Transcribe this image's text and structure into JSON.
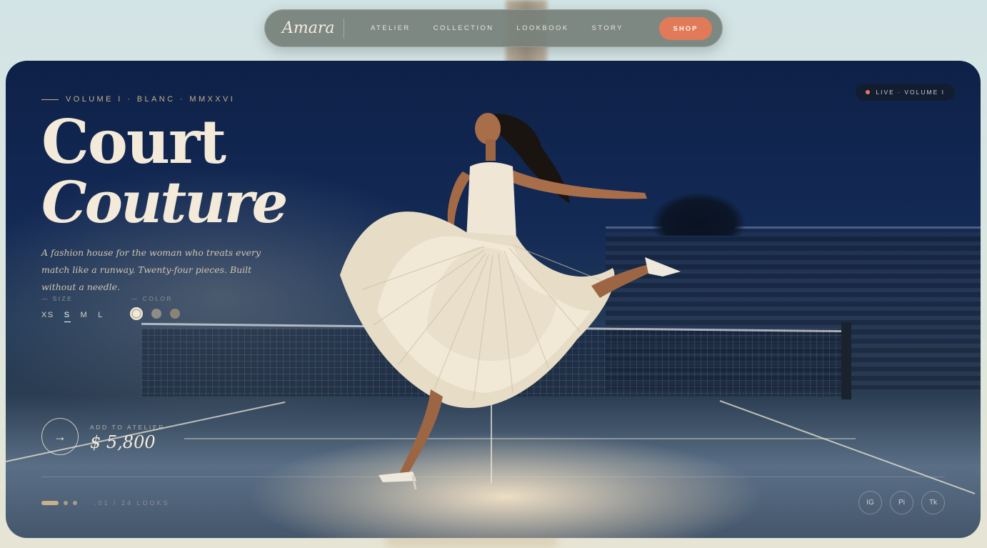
{
  "nav": {
    "brand": "Amara",
    "links": [
      "ATELIER",
      "COLLECTION",
      "LOOKBOOK",
      "STORY"
    ],
    "cta": "SHOP"
  },
  "hero": {
    "eyebrow": "VOLUME I · BLANC · MMXXVI",
    "title_line1": "Court",
    "title_line2": "Couture",
    "trademark": "™",
    "tagline": "A fashion house for the woman who treats every match like a runway. Twenty-four pieces. Built without a needle.",
    "size_label": "— SIZE",
    "sizes": [
      "XS",
      "S",
      "M",
      "L"
    ],
    "selected_size": "S",
    "color_label": "— COLOR",
    "colors": [
      "#f3ead9",
      "#8e8c85",
      "#8a8476"
    ],
    "cta_label": "ADD TO ATELIER",
    "price": "$ 5,800",
    "arrow": "→",
    "looks": ".01 / 24 LOOKS",
    "live_badge": "LIVE · VOLUME I",
    "socials": [
      "IG",
      "Pi",
      "Tk"
    ]
  },
  "colors": {
    "accent": "#e17a58",
    "gold": "#c8b08a",
    "ink": "#0e2148",
    "cream": "#f3ead9"
  }
}
